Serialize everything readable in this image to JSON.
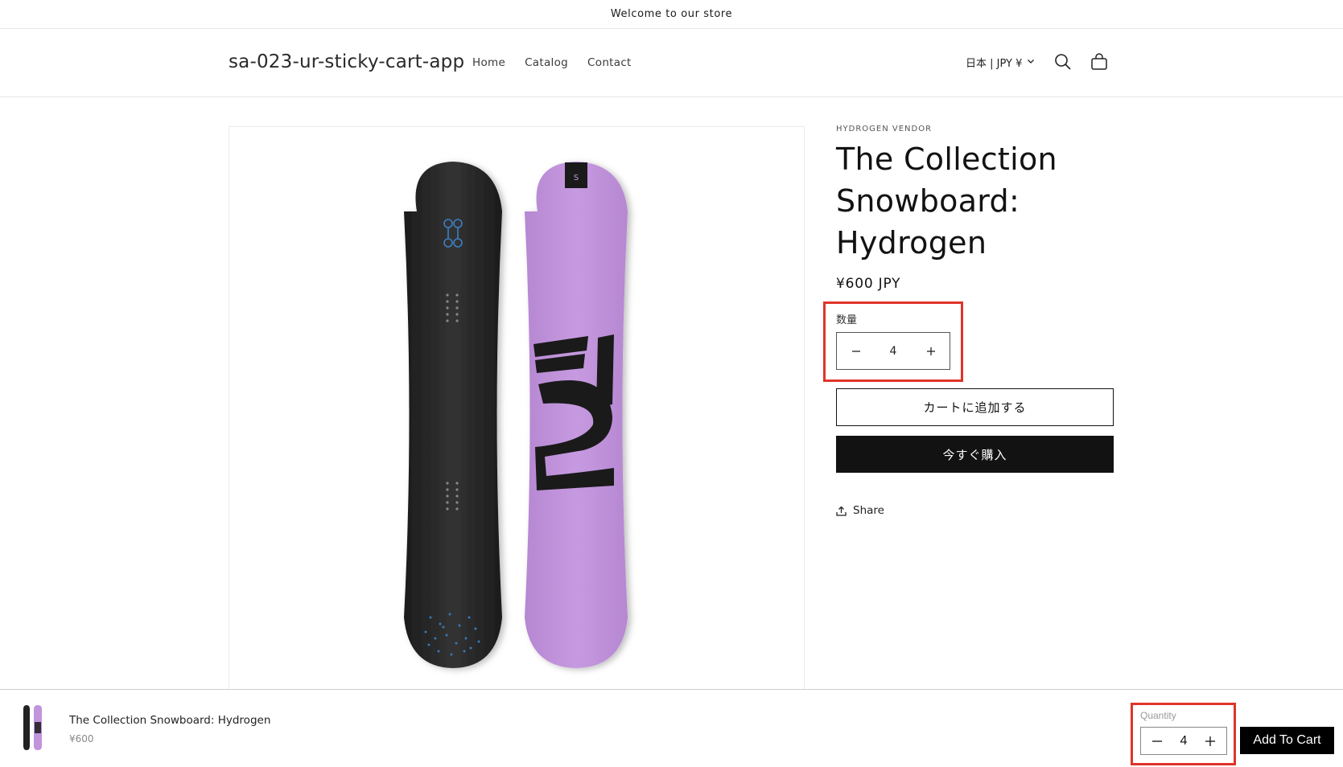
{
  "announcement": {
    "text": "Welcome to our store"
  },
  "header": {
    "logo": "sa-023-ur-sticky-cart-app",
    "nav": [
      "Home",
      "Catalog",
      "Contact"
    ],
    "locale": "日本 | JPY ¥",
    "icons": [
      "search-icon",
      "cart-icon",
      "chevron-down-icon"
    ]
  },
  "product": {
    "vendor": "HYDROGEN VENDOR",
    "title": "The Collection Snowboard: Hydrogen",
    "price": "¥600 JPY",
    "quantity_label": "数量",
    "quantity": "4",
    "add_to_cart": "カートに追加する",
    "buy_now": "今すぐ購入",
    "share": "Share",
    "image": {
      "board_left_color": "#2b2b2b",
      "board_right_color": "#c194dc",
      "brand_mark": "H2"
    }
  },
  "sticky_cart": {
    "title": "The Collection Snowboard: Hydrogen",
    "price": "¥600",
    "quantity_label": "Quantity",
    "quantity": "4",
    "add_button": "Add To Cart"
  },
  "colors": {
    "accent_highlight": "#e0342a",
    "button_dark": "#121212",
    "text": "#121212"
  }
}
